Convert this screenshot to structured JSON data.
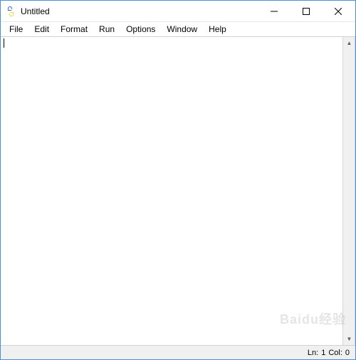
{
  "window": {
    "title": "Untitled"
  },
  "menu": {
    "items": [
      "File",
      "Edit",
      "Format",
      "Run",
      "Options",
      "Window",
      "Help"
    ]
  },
  "editor": {
    "content": ""
  },
  "status": {
    "line_label": "Ln:",
    "line": "1",
    "col_label": "Col:",
    "col": "0"
  },
  "watermark": "Baidu经验"
}
